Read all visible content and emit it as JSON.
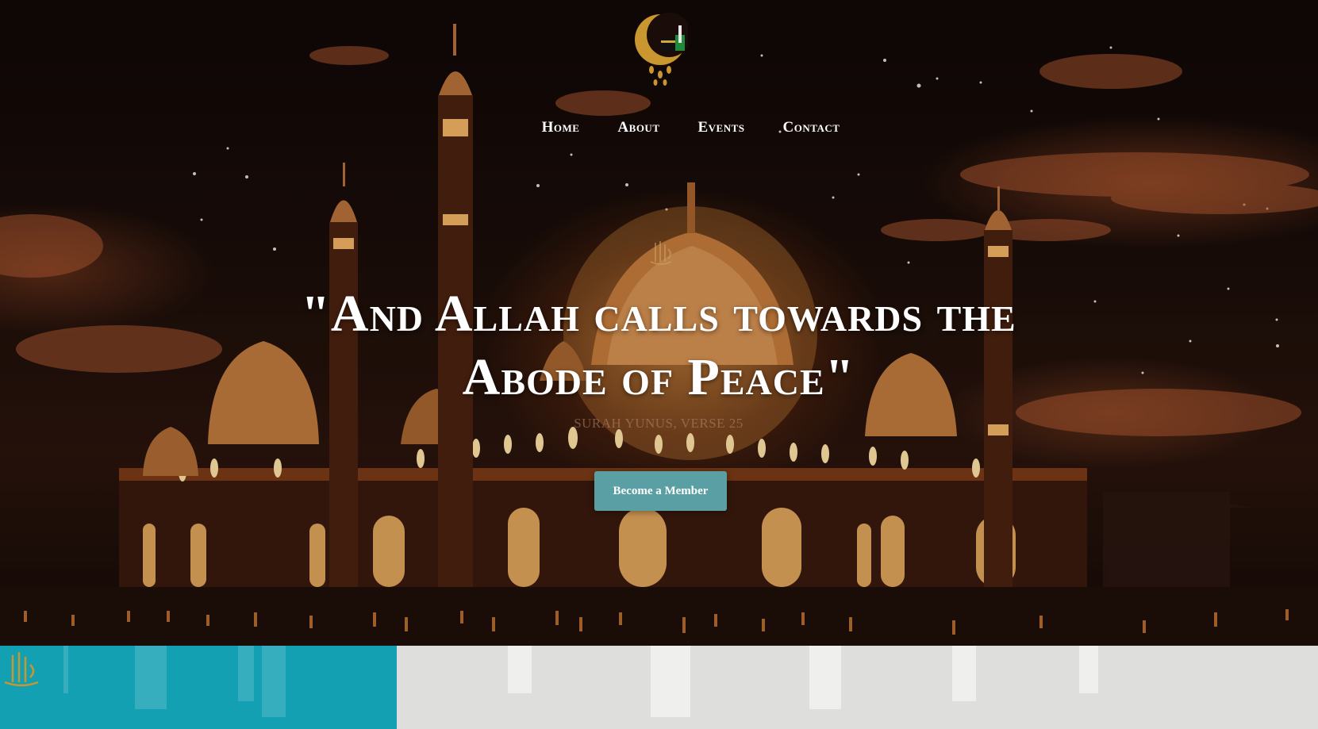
{
  "header": {
    "logo_icon": "crescent-kaaba-logo"
  },
  "nav": {
    "items": [
      {
        "label": "Home"
      },
      {
        "label": "About"
      },
      {
        "label": "Events"
      },
      {
        "label": "Contact"
      }
    ]
  },
  "hero": {
    "background": "illuminated-mosque-night-scene",
    "ornament_icon": "allah-calligraphy-icon",
    "headline_line1": "\"And Allah calls towards the",
    "headline_line2": "Abode of Peace\"",
    "verse": "SURAH YUNUS, VERSE 25",
    "cta_label": "Become a Member"
  },
  "sections": {
    "left_panel_icon": "allah-calligraphy-icon"
  },
  "colors": {
    "cta": "#5a9fa4",
    "teal_panel": "#13a0b3",
    "light_panel": "#dededd",
    "gold": "#c9962f"
  }
}
